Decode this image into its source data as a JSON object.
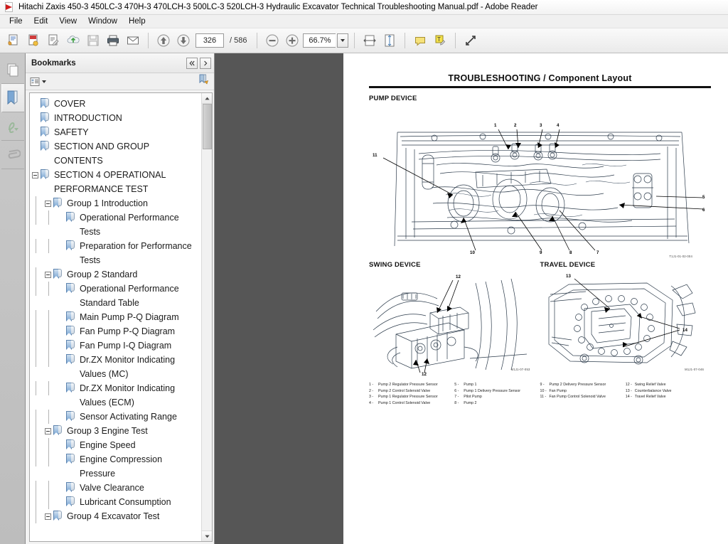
{
  "window": {
    "title": "Hitachi Zaxis 450-3 450LC-3 470H-3 470LCH-3 500LC-3 520LCH-3 Hydraulic Excavator Technical Troubleshooting Manual.pdf - Adobe Reader",
    "app_icon": "pdf-icon"
  },
  "menubar": {
    "items": [
      {
        "label": "File"
      },
      {
        "label": "Edit"
      },
      {
        "label": "View"
      },
      {
        "label": "Window"
      },
      {
        "label": "Help"
      }
    ]
  },
  "toolbar": {
    "buttons": [
      {
        "name": "open-file-icon"
      },
      {
        "name": "create-pdf-icon"
      },
      {
        "name": "edit-pdf-icon"
      },
      {
        "name": "upload-cloud-icon"
      },
      {
        "name": "save-icon"
      },
      {
        "name": "print-icon"
      },
      {
        "name": "email-icon"
      },
      {
        "name": "previous-page-icon"
      },
      {
        "name": "next-page-icon"
      },
      {
        "name": "zoom-out-icon"
      },
      {
        "name": "zoom-in-icon"
      },
      {
        "name": "fit-width-icon"
      },
      {
        "name": "fit-page-icon"
      },
      {
        "name": "sticky-note-icon"
      },
      {
        "name": "highlight-text-icon"
      },
      {
        "name": "read-mode-icon"
      }
    ],
    "page_current": "326",
    "page_total": "/ 586",
    "zoom_level": "66.7%"
  },
  "rail": {
    "items": [
      {
        "name": "page-thumbnails-icon",
        "active": false
      },
      {
        "name": "bookmarks-icon",
        "active": true
      },
      {
        "name": "signatures-icon",
        "active": false
      },
      {
        "name": "attachments-icon",
        "active": false
      }
    ]
  },
  "bookmarks_panel": {
    "title": "Bookmarks",
    "collapse_label": "◂◂",
    "expand_label": "▸",
    "options_icon": "bookmark-options-icon",
    "new_bookmark_icon": "new-bookmark-icon",
    "items": [
      {
        "label": "COVER",
        "depth": 0,
        "expander": false
      },
      {
        "label": "INTRODUCTION",
        "depth": 0,
        "expander": false
      },
      {
        "label": "SAFETY",
        "depth": 0,
        "expander": false
      },
      {
        "label": "SECTION AND GROUP CONTENTS",
        "depth": 0,
        "expander": false
      },
      {
        "label": "SECTION 4 OPERATIONAL PERFORMANCE TEST",
        "depth": 0,
        "expander": true
      },
      {
        "label": "Group 1 Introduction",
        "depth": 1,
        "expander": true
      },
      {
        "label": "Operational Performance Tests",
        "depth": 2,
        "expander": false
      },
      {
        "label": "Preparation for Performance Tests",
        "depth": 2,
        "expander": false
      },
      {
        "label": "Group 2 Standard",
        "depth": 1,
        "expander": true
      },
      {
        "label": "Operational Performance Standard Table",
        "depth": 2,
        "expander": false
      },
      {
        "label": "Main Pump P-Q Diagram",
        "depth": 2,
        "expander": false
      },
      {
        "label": "Fan Pump P-Q Diagram",
        "depth": 2,
        "expander": false
      },
      {
        "label": "Fan Pump I-Q Diagram",
        "depth": 2,
        "expander": false
      },
      {
        "label": "Dr.ZX Monitor Indicating Values (MC)",
        "depth": 2,
        "expander": false
      },
      {
        "label": "Dr.ZX Monitor Indicating Values (ECM)",
        "depth": 2,
        "expander": false
      },
      {
        "label": "Sensor Activating Range",
        "depth": 2,
        "expander": false
      },
      {
        "label": "Group 3 Engine Test",
        "depth": 1,
        "expander": true
      },
      {
        "label": "Engine Speed",
        "depth": 2,
        "expander": false
      },
      {
        "label": "Engine Compression Pressure",
        "depth": 2,
        "expander": false
      },
      {
        "label": "Valve Clearance",
        "depth": 2,
        "expander": false
      },
      {
        "label": "Lubricant Consumption",
        "depth": 2,
        "expander": false
      },
      {
        "label": "Group 4 Excavator Test",
        "depth": 1,
        "expander": true
      }
    ]
  },
  "document": {
    "header": "TROUBLESHOOTING / Component Layout",
    "sections": {
      "pump": "PUMP DEVICE",
      "swing": "SWING DEVICE",
      "travel": "TRAVEL DEVICE"
    },
    "figure_codes": {
      "pump": "T1J1-01-02-004",
      "swing": "M1J1-07-053",
      "travel": "M1J1-07-046"
    },
    "callouts": {
      "pump": [
        "1",
        "2",
        "3",
        "4",
        "5",
        "6",
        "7",
        "8",
        "9",
        "10",
        "11"
      ],
      "swing": [
        "12",
        "12"
      ],
      "travel": [
        "13",
        "14"
      ]
    },
    "legend_columns": [
      [
        {
          "num": "1 -",
          "text": "Pump 2 Regulator Pressure Sensor"
        },
        {
          "num": "2 -",
          "text": "Pump 2 Control Solenoid Valve"
        },
        {
          "num": "3 -",
          "text": "Pump 1 Regulator Pressure Sensor"
        },
        {
          "num": "4 -",
          "text": "Pump 1 Control Solenoid Valve"
        }
      ],
      [
        {
          "num": "5 -",
          "text": "Pump 1"
        },
        {
          "num": "6 -",
          "text": "Pump 1 Delivery Pressure Sensor"
        },
        {
          "num": "7 -",
          "text": "Pilot Pump"
        },
        {
          "num": "8 -",
          "text": "Pump 2"
        }
      ],
      [
        {
          "num": "9 -",
          "text": "Pump 2 Delivery Pressure Sensor"
        },
        {
          "num": "10 -",
          "text": "Fan Pump"
        },
        {
          "num": "11 -",
          "text": "Fan Pump Control Solenoid Valve"
        }
      ],
      [
        {
          "num": "12 -",
          "text": "Swing Relief Valve"
        },
        {
          "num": "13 -",
          "text": "Counterbalance Valve"
        },
        {
          "num": "14 -",
          "text": "Travel Relief Valve"
        }
      ]
    ]
  },
  "colors": {
    "accent": "#7ba7d4",
    "viewer_bg": "#565656",
    "chrome": "#f0f0f0"
  }
}
